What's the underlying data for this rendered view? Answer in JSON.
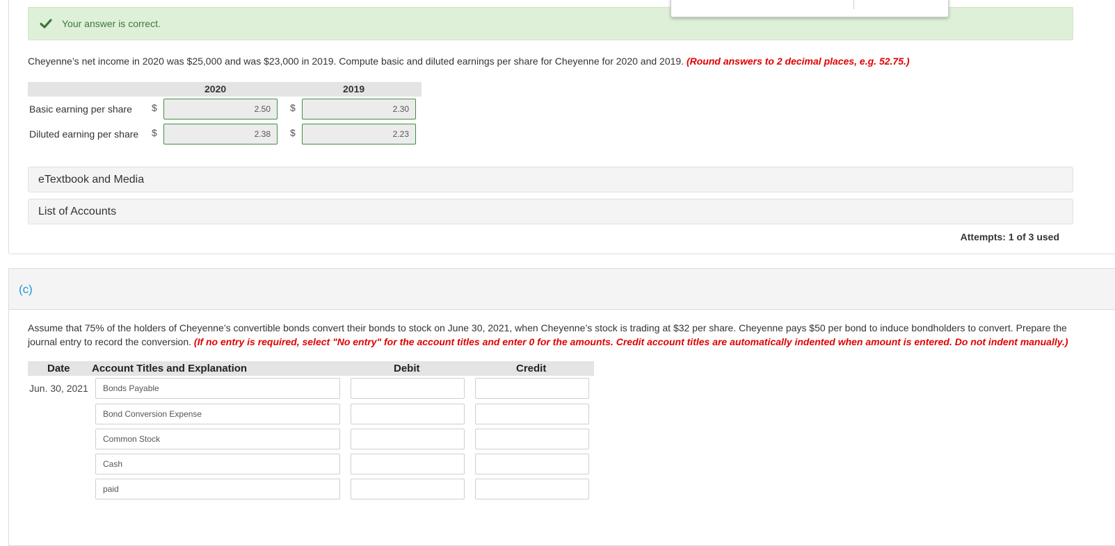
{
  "popup": {
    "glyph": "ʼʼ"
  },
  "result": {
    "message": "Your answer is correct.",
    "status_color": "#3c763d"
  },
  "part_b": {
    "question": "Cheyenne’s net income in 2020 was $25,000 and was $23,000 in 2019. Compute basic and diluted earnings per share for Cheyenne for 2020 and 2019.",
    "instruction": "(Round answers to 2 decimal places, e.g. 52.75.)",
    "columns": [
      "2020",
      "2019"
    ],
    "currency_symbol": "$",
    "rows": [
      {
        "label": "Basic earning per share",
        "values": [
          "2.50",
          "2.30"
        ]
      },
      {
        "label": "Diluted earning per share",
        "values": [
          "2.38",
          "2.23"
        ]
      }
    ],
    "etextbook_label": "eTextbook and Media",
    "accounts_label": "List of Accounts",
    "attempts": "Attempts: 1 of 3 used"
  },
  "part_c": {
    "label": "(c)",
    "question": "Assume that 75% of the holders of Cheyenne’s convertible bonds convert their bonds to stock on June 30, 2021, when Cheyenne’s stock is trading at $32 per share. Cheyenne pays $50 per bond to induce bondholders to convert. Prepare the journal entry to record the conversion.",
    "instruction": "(If no entry is required, select \"No entry\" for the account titles and enter 0 for the amounts. Credit account titles are automatically indented when amount is entered. Do not indent manually.)",
    "headers": {
      "date": "Date",
      "account": "Account Titles and Explanation",
      "debit": "Debit",
      "credit": "Credit"
    },
    "date": "Jun. 30, 2021",
    "entries": [
      {
        "account": "Bonds Payable",
        "debit": "",
        "credit": ""
      },
      {
        "account": "Bond Conversion Expense",
        "debit": "",
        "credit": ""
      },
      {
        "account": "Common Stock",
        "debit": "",
        "credit": ""
      },
      {
        "account": "Cash",
        "debit": "",
        "credit": ""
      },
      {
        "account": "paid",
        "debit": "",
        "credit": ""
      }
    ]
  },
  "colors": {
    "accent_blue": "#1e9ad6",
    "instruction_red": "#e00000",
    "correct_bg": "#dff0d8",
    "input_border_correct": "#3e8e41"
  }
}
